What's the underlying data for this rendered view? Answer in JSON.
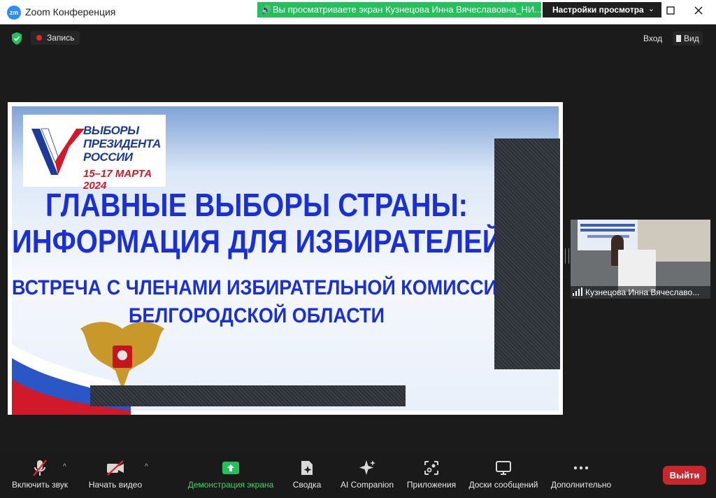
{
  "window": {
    "title": "Zoom Конференция",
    "logo_text": "zm"
  },
  "share_banner": {
    "text": "Вы просматриваете экран Кузнецова Инна Вячеславовна_НИ..."
  },
  "view_settings": {
    "label": "Настройки просмотра"
  },
  "meeting": {
    "record_label": "Запись",
    "login_label": "Вход",
    "view_label": "Вид"
  },
  "slide": {
    "logo_lines": [
      "ВЫБОРЫ",
      "ПРЕЗИДЕНТА",
      "РОССИИ"
    ],
    "logo_date": "15–17 МАРТА 2024",
    "heading1": "ГЛАВНЫЕ ВЫБОРЫ СТРАНЫ:",
    "heading2": "ИНФОРМАЦИЯ ДЛЯ ИЗБИРАТЕЛЕЙ",
    "heading3": "ВСТРЕЧА С ЧЛЕНАМИ ИЗБИРАТЕЛЬНОЙ КОМИССИИ",
    "heading4": "БЕЛГОРОДСКОЙ ОБЛАСТИ"
  },
  "participant": {
    "name": "Кузнецова Инна Вячеславо..."
  },
  "toolbar": {
    "unmute": "Включить звук",
    "start_video": "Начать видео",
    "share_screen": "Демонстрация экрана",
    "summary": "Сводка",
    "ai_companion": "AI Companion",
    "apps": "Приложения",
    "whiteboards": "Доски сообщений",
    "more": "Дополнительно",
    "exit": "Выйти"
  },
  "colors": {
    "share_green": "#23c05b",
    "exit_red": "#c8272d",
    "slide_blue": "#1a2fd6"
  }
}
